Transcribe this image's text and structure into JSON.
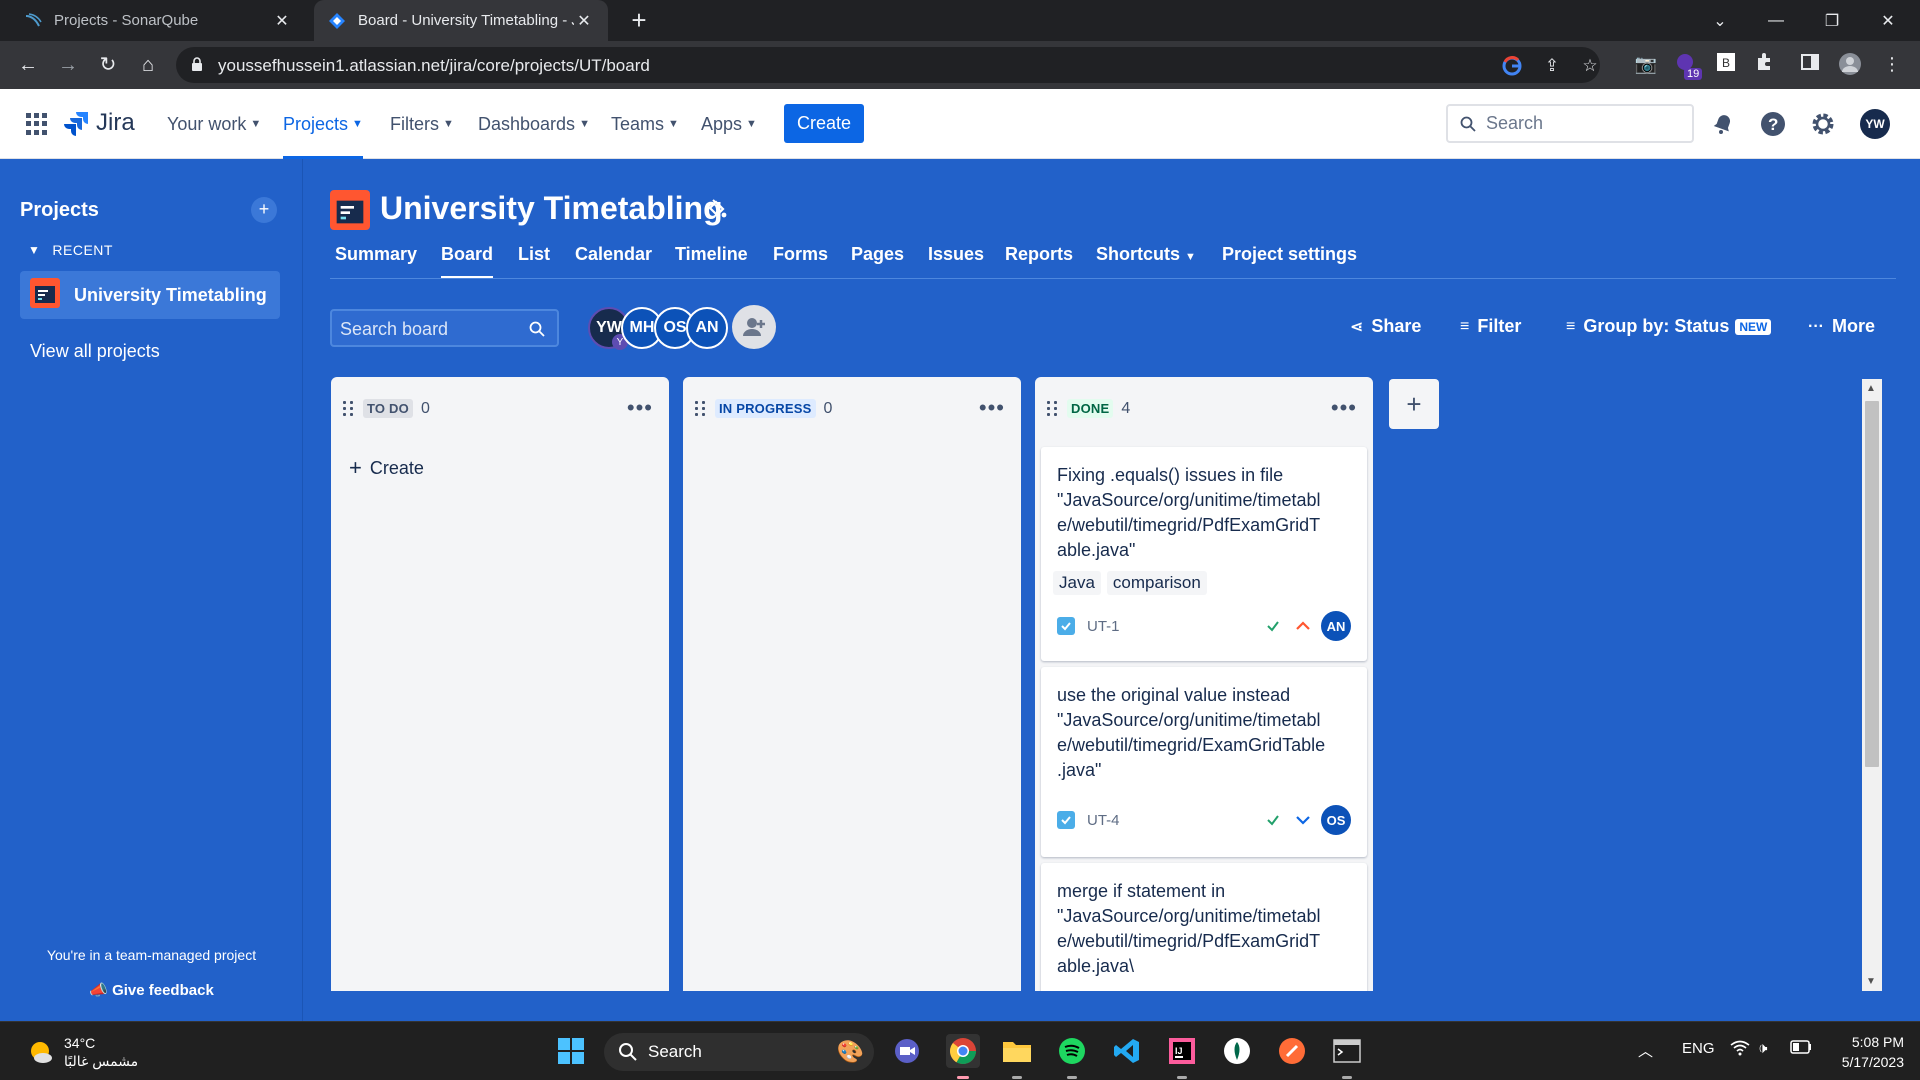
{
  "browser": {
    "tabs": [
      {
        "title": "Projects - SonarQube",
        "active": false
      },
      {
        "title": "Board - University Timetabling - J",
        "active": true
      }
    ],
    "url": "youssefhussein1.atlassian.net/jira/core/projects/UT/board",
    "ext_badge": "19"
  },
  "jira_nav": {
    "logo": "Jira",
    "items": [
      "Your work",
      "Projects",
      "Filters",
      "Dashboards",
      "Teams",
      "Apps"
    ],
    "active_item": "Projects",
    "create": "Create",
    "search_placeholder": "Search",
    "user_initials": "YW"
  },
  "sidebar": {
    "title": "Projects",
    "recent_label": "RECENT",
    "recent_project": "University Timetabling",
    "view_all": "View all projects",
    "team_note": "You're in a team-managed project",
    "feedback": "Give feedback"
  },
  "project": {
    "title": "University Timetabling",
    "tabs": [
      "Summary",
      "Board",
      "List",
      "Calendar",
      "Timeline",
      "Forms",
      "Pages",
      "Issues",
      "Reports",
      "Shortcuts",
      "Project settings"
    ],
    "active_tab": "Board"
  },
  "board": {
    "search_placeholder": "Search board",
    "avatars": [
      "YW",
      "MH",
      "OS",
      "AN"
    ],
    "avatar_sub": "Y",
    "share": "Share",
    "filter": "Filter",
    "group_by": "Group by: Status",
    "new_badge": "NEW",
    "more": "More",
    "columns": [
      {
        "name": "TO DO",
        "count": "0",
        "create": "Create",
        "color": "#dfe1e6",
        "text_color": "#42526e"
      },
      {
        "name": "IN PROGRESS",
        "count": "0",
        "color": "#deebff",
        "text_color": "#0747a6"
      },
      {
        "name": "DONE",
        "count": "4",
        "color": "#e3fcef",
        "text_color": "#006644"
      }
    ],
    "cards": [
      {
        "summary": "Fixing .equals() issues in file \"JavaSource/org/unitime/timetable/webutil/timegrid/PdfExamGridTable.java\"",
        "labels": [
          "Java",
          "comparison"
        ],
        "key": "UT-1",
        "priority": "high",
        "assignee": "AN"
      },
      {
        "summary": "use the original value instead \"JavaSource/org/unitime/timetable/webutil/timegrid/ExamGridTable.java\"",
        "labels": [],
        "key": "UT-4",
        "priority": "low",
        "assignee": "OS"
      },
      {
        "summary": "merge if statement in \"JavaSource/org/unitime/timetable/webutil/timegrid/PdfExamGridTable.java\\",
        "labels": [],
        "key": "",
        "priority": "",
        "assignee": ""
      }
    ]
  },
  "taskbar": {
    "temperature": "34°C",
    "weather_text": "مشمس غالبًا",
    "search": "Search",
    "lang": "ENG",
    "time": "5:08 PM",
    "date": "5/17/2023"
  },
  "colors": {
    "board_bg": "#2261c9",
    "jira_blue": "#0c66e4",
    "avatar_blue": "#0c52b8"
  }
}
